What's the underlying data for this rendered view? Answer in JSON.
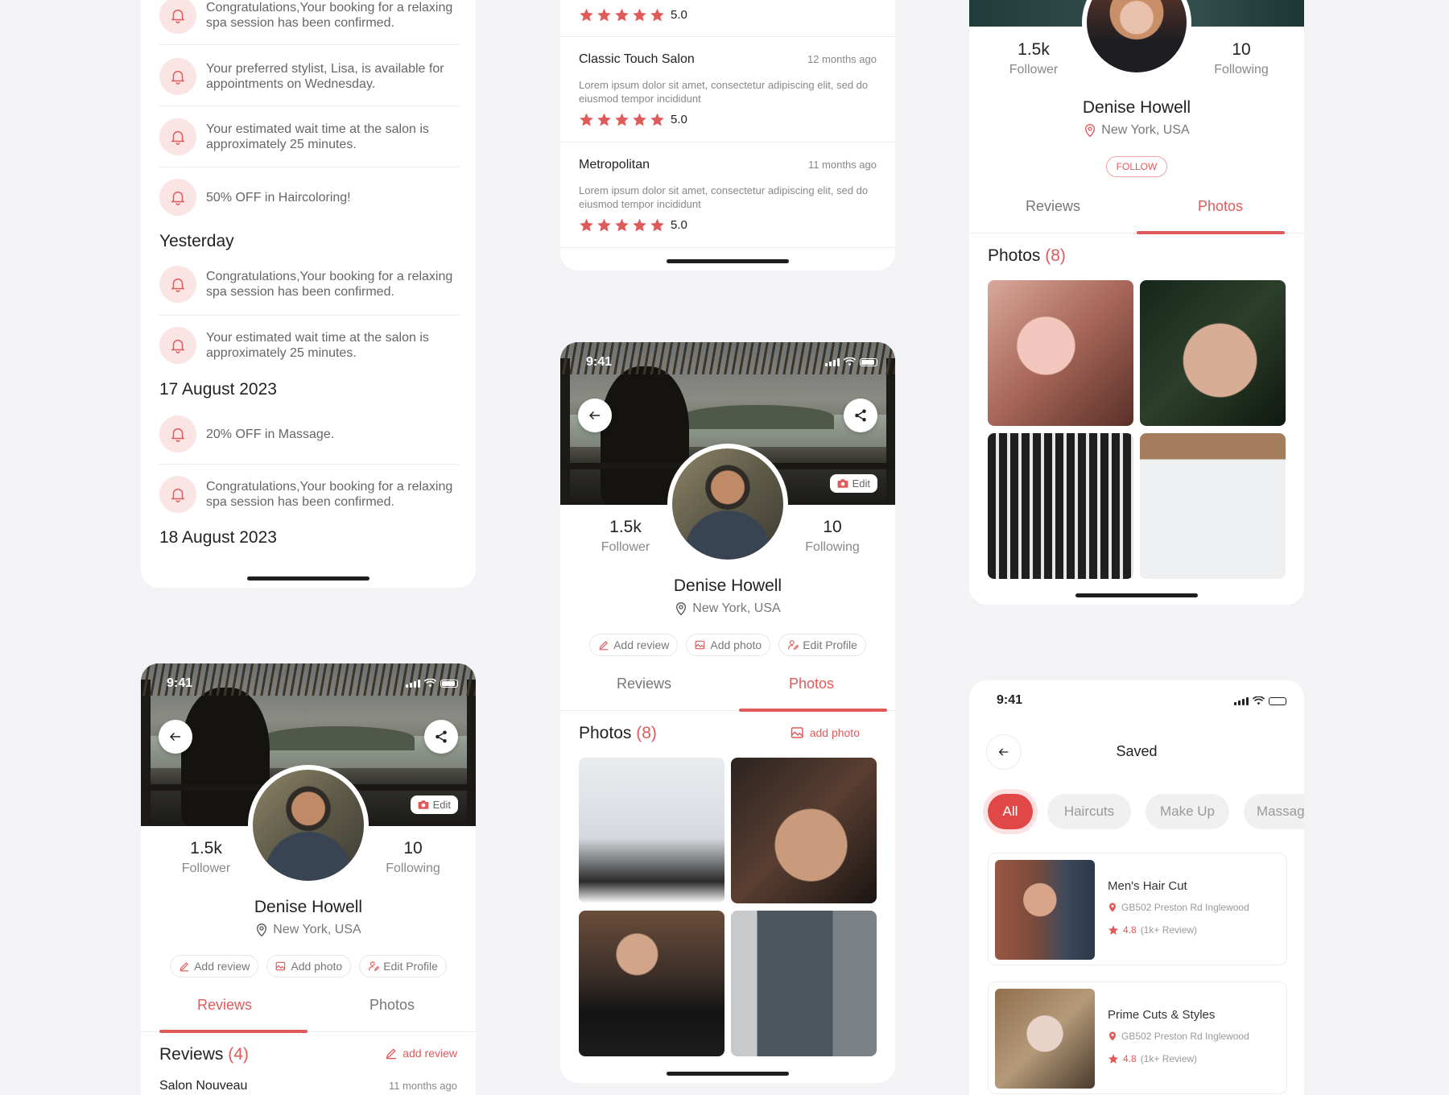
{
  "notifications_screen": {
    "today_items": [
      {
        "text": "Congratulations,Your booking for a relaxing spa session has been confirmed."
      },
      {
        "text": "Your preferred stylist, Lisa, is available for appointments on Wednesday."
      },
      {
        "text": "Your estimated wait time at the salon is approximately 25 minutes."
      },
      {
        "text": "50% OFF in Haircoloring!"
      }
    ],
    "yesterday_label": "Yesterday",
    "yesterday_items": [
      {
        "text": "Congratulations,Your booking for a relaxing spa session has been confirmed."
      },
      {
        "text": "Your estimated wait time at the salon is approximately 25 minutes."
      }
    ],
    "aug17_label": "17 August 2023",
    "aug17_items": [
      {
        "text": "20% OFF in Massage."
      },
      {
        "text": "Congratulations,Your booking for a relaxing spa session has been confirmed."
      }
    ],
    "aug18_label": "18 August 2023"
  },
  "reviews_list_screen": {
    "first_rating": "5.0",
    "reviews": [
      {
        "name": "Classic Touch Salon",
        "date": "12 months ago",
        "body": "Lorem ipsum dolor sit amet, consectetur adipiscing elit, sed do eiusmod tempor incididunt",
        "rating": "5.0"
      },
      {
        "name": "Metropolitan",
        "date": "11 months ago",
        "body": "Lorem ipsum dolor sit amet, consectetur adipiscing elit, sed do eiusmod tempor incididunt",
        "rating": "5.0"
      }
    ]
  },
  "profile_photos_screen": {
    "status_time": "9:41",
    "edit_label": "Edit",
    "follower_count": "1.5k",
    "follower_label": "Follower",
    "following_count": "10",
    "following_label": "Following",
    "name": "Denise Howell",
    "location": "New York, USA",
    "add_review": "Add review",
    "add_photo": "Add photo",
    "edit_profile": "Edit Profile",
    "tab_reviews": "Reviews",
    "tab_photos": "Photos",
    "section_title": "Photos",
    "section_count": "(8)",
    "section_action": "add photo"
  },
  "profile_reviews_screen": {
    "status_time": "9:41",
    "edit_label": "Edit",
    "follower_count": "1.5k",
    "follower_label": "Follower",
    "following_count": "10",
    "following_label": "Following",
    "name": "Denise Howell",
    "location": "New York, USA",
    "add_review": "Add review",
    "add_photo": "Add photo",
    "edit_profile": "Edit Profile",
    "tab_reviews": "Reviews",
    "tab_photos": "Photos",
    "section_title": "Reviews",
    "section_count": "(4)",
    "section_action": "add review",
    "first_review_name": "Salon Nouveau",
    "first_review_date": "11 months ago"
  },
  "public_profile_screen": {
    "follower_count": "1.5k",
    "follower_label": "Follower",
    "following_count": "10",
    "following_label": "Following",
    "name": "Denise Howell",
    "location": "New York, USA",
    "follow_button": "FOLLOW",
    "tab_reviews": "Reviews",
    "tab_photos": "Photos",
    "section_title": "Photos",
    "section_count": "(8)"
  },
  "saved_screen": {
    "status_time": "9:41",
    "title": "Saved",
    "filters": [
      "All",
      "Haircuts",
      "Make Up",
      "Massage"
    ],
    "items": [
      {
        "name": "Men's Hair Cut",
        "address": "GB502 Preston Rd Inglewood",
        "rating": "4.8",
        "reviews": "(1k+ Review)"
      },
      {
        "name": "Prime Cuts & Styles",
        "address": "GB502 Preston Rd Inglewood",
        "rating": "4.8",
        "reviews": "(1k+ Review)"
      }
    ]
  },
  "colors": {
    "accent": "#e05a5a",
    "background": "#f3f3f5",
    "card": "#ffffff"
  }
}
